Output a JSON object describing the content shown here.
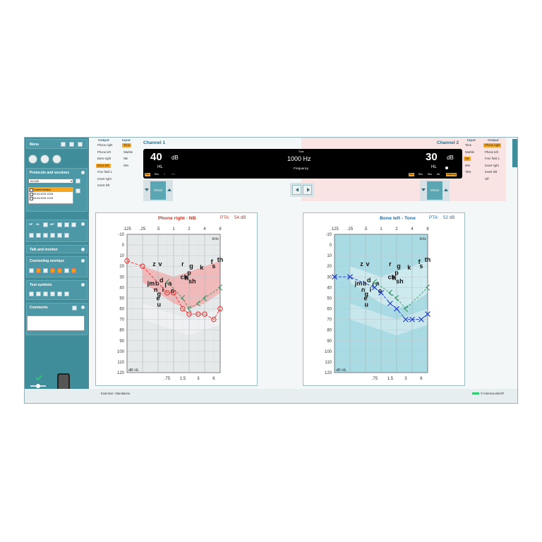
{
  "sidebar": {
    "menu_label": "Menu",
    "protocols_title": "Protocols and sessions",
    "protocol_value": "AC440",
    "sessions": [
      "Current session",
      "29-04-2015 13:54",
      "23-04-2015 11:05"
    ],
    "test_icon_labels": [
      "HF",
      "HL",
      "MF"
    ],
    "talk_monitor": "Talk and monitor",
    "counseling_overlays": "Counseling overlays",
    "test_symbols": "Test symbols",
    "comments": "Comments"
  },
  "channel1": {
    "title": "Channel 1",
    "output_header": "Output",
    "input_header": "Input",
    "outputs": [
      "Phone right",
      "Phone left",
      "Bone right",
      "Bone left",
      "Free field 1",
      "Insert right",
      "Insert left"
    ],
    "output_selected": 3,
    "inputs": [
      "Tone",
      "Warble",
      "NB",
      "WN"
    ],
    "input_selected": 0,
    "level": "40",
    "unit": "dB",
    "hl": "HL",
    "tags": [
      "Rev",
      "Rev",
      "⎍",
      "⎍⎍"
    ],
    "stimuli": "Stimuli"
  },
  "channel2": {
    "title": "Channel 2",
    "input_header": "Input",
    "output_header": "Output",
    "inputs": [
      "Tone",
      "Warble",
      "NB",
      "WN",
      "TEN"
    ],
    "input_selected": 2,
    "outputs": [
      "Phone right",
      "Phone left",
      "Free field 1",
      "Insert right",
      "Insert left",
      "Off"
    ],
    "output_selected": 0,
    "level": "30",
    "unit": "dB",
    "hl": "HL",
    "tags": [
      "Rev",
      "Rev",
      "Sim",
      "Alt",
      "Masking"
    ],
    "stimuli": "Stimuli"
  },
  "display": {
    "tone_label": "Tone",
    "frequency_value": "1000 Hz",
    "frequency_label": "Frequency"
  },
  "left_audiogram": {
    "title": "Phone right - NB",
    "pta_label": "PTA:",
    "pta_value": "54 dB",
    "symbol": "circle",
    "color": "#e53935"
  },
  "right_audiogram": {
    "title": "Bone left - Tone",
    "pta_label": "PTA:",
    "pta_value": "52 dB",
    "symbol": "cross",
    "color": "#1e3fd0"
  },
  "axis": {
    "top_ticks": [
      ".125",
      ".25",
      ".5",
      "1",
      "2",
      "4",
      "8"
    ],
    "top_unit": "kHz",
    "bottom_ticks": [
      ".75",
      "1.5",
      "3",
      "6"
    ],
    "y_ticks": [
      "-10",
      "0",
      "10",
      "20",
      "30",
      "40",
      "50",
      "60",
      "70",
      "80",
      "90",
      "100",
      "110",
      "120"
    ],
    "y_unit": "dB HL"
  },
  "speech_letters": [
    "z",
    "v",
    "j",
    "m",
    "b",
    "d",
    "n",
    "g",
    "e",
    "l",
    "u",
    "i",
    "a",
    "o",
    "r",
    "p",
    "h",
    "g",
    "ch",
    "sh",
    "k",
    "f",
    "s",
    "th"
  ],
  "status": {
    "examiner": "Examiner: Standalone",
    "brand": "© Interacoustics®"
  },
  "chart_data": [
    {
      "type": "line",
      "title": "Phone right - NB",
      "x_labels": [
        ".125",
        ".25",
        ".5",
        ".75",
        "1",
        "1.5",
        "2",
        "3",
        "4",
        "6",
        "8"
      ],
      "x_khz": [
        0.125,
        0.25,
        0.75,
        1,
        1.5,
        2,
        3,
        4,
        6,
        8
      ],
      "series": [
        {
          "name": "Phone right - NB",
          "x_khz": [
            0.125,
            0.25,
            0.75,
            1,
            1.5,
            2,
            3,
            4,
            6,
            8
          ],
          "values": [
            15,
            20,
            45,
            45,
            60,
            65,
            65,
            65,
            70,
            60
          ]
        }
      ],
      "masked_bone_x_khz": [
        0.75,
        1.5,
        2,
        3,
        4,
        8
      ],
      "masked_bone_values": [
        35,
        50,
        60,
        55,
        50,
        40
      ],
      "ylim": [
        -10,
        120
      ]
    },
    {
      "type": "line",
      "title": "Bone left - Tone",
      "series": [
        {
          "name": "Bone left - Tone",
          "x_khz": [
            0.125,
            0.25,
            0.75,
            1,
            1.5,
            2,
            3,
            4,
            6,
            8
          ],
          "values": [
            30,
            30,
            40,
            45,
            55,
            60,
            70,
            70,
            70,
            65
          ]
        }
      ],
      "masked_bone_x_khz": [
        0.75,
        1.5,
        2,
        3,
        8
      ],
      "masked_bone_values": [
        35,
        45,
        50,
        60,
        40
      ],
      "ylim": [
        -10,
        120
      ]
    }
  ]
}
